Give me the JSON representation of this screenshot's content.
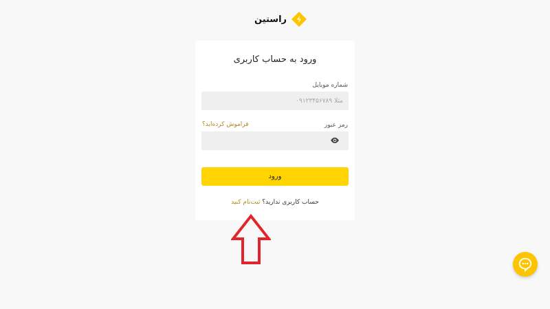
{
  "brand": {
    "name": "راستین",
    "accent_color": "#ffd400",
    "logo_icon": "brand-logo-icon"
  },
  "login": {
    "title": "ورود به حساب کاربری",
    "mobile_label": "شماره موبایل",
    "mobile_placeholder": "مثلا ۰۹۱۲۳۴۵۶۷۸۹",
    "password_label": "رمز عبور",
    "forgot_link": "فراموش کرده‌اید؟",
    "password_toggle_icon": "eye-icon",
    "submit_label": "ورود",
    "no_account_text": "حساب کاربری ندارید؟",
    "signup_link": "ثبت‌نام کنید"
  },
  "annotation": {
    "arrow_icon": "red-up-arrow-icon",
    "arrow_color": "#e0262b"
  },
  "chat_widget": {
    "icon": "chat-bubble-icon",
    "color": "#ffc400"
  }
}
